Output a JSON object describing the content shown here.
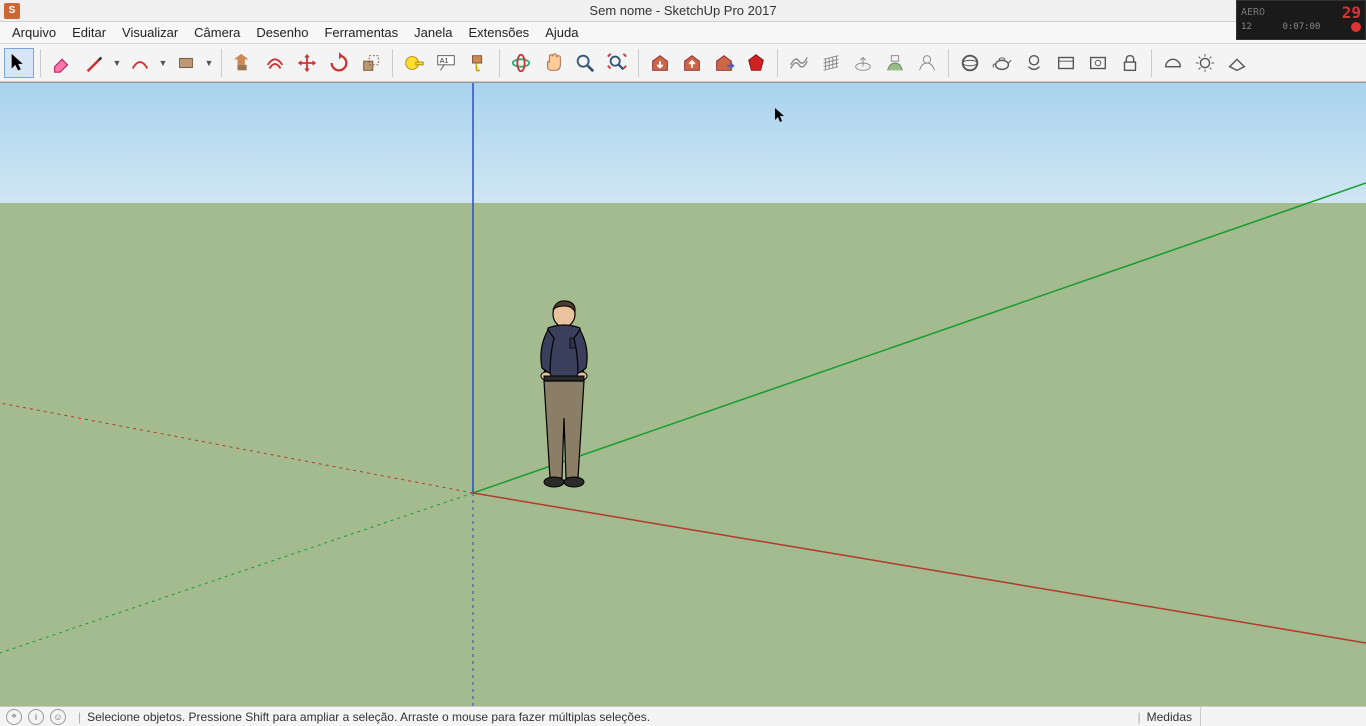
{
  "title": "Sem nome - SketchUp Pro 2017",
  "overlay": {
    "label": "AERO",
    "big": "29",
    "small": "12",
    "time": "0:07:00"
  },
  "menu": [
    "Arquivo",
    "Editar",
    "Visualizar",
    "Câmera",
    "Desenho",
    "Ferramentas",
    "Janela",
    "Extensões",
    "Ajuda"
  ],
  "toolbar": {
    "select": "select",
    "eraser": "eraser",
    "pencil": "pencil",
    "arc": "arc",
    "rect": "rect",
    "pushpull": "pushpull",
    "offset": "offset",
    "move": "move",
    "rotate": "rotate",
    "scale": "scale",
    "tape": "tape",
    "text": "text",
    "paint": "paint",
    "orbit": "orbit",
    "pan": "pan",
    "zoom": "zoom",
    "zoomextents": "zoomextents",
    "3dwarehouse": "3dwarehouse",
    "3dwarehouse2": "3dwarehouse2",
    "share": "share",
    "ruby": "ruby",
    "sandbox1": "sandbox1",
    "sandbox2": "sandbox2",
    "sandbox3": "sandbox3",
    "sandbox4": "sandbox4",
    "sandbox5": "sandbox5",
    "vray1": "vray1",
    "vray2": "vray2",
    "vray3": "vray3",
    "vray4": "vray4",
    "vray5": "vray5",
    "vray6": "vray6",
    "vray7": "vray7",
    "vray8": "vray8",
    "vray9": "vray9",
    "vray10": "vray10"
  },
  "status": {
    "hint": "Selecione objetos. Pressione Shift para ampliar a seleção. Arraste o mouse para fazer múltiplas seleções.",
    "measurements_label": "Medidas",
    "measurements_value": ""
  }
}
